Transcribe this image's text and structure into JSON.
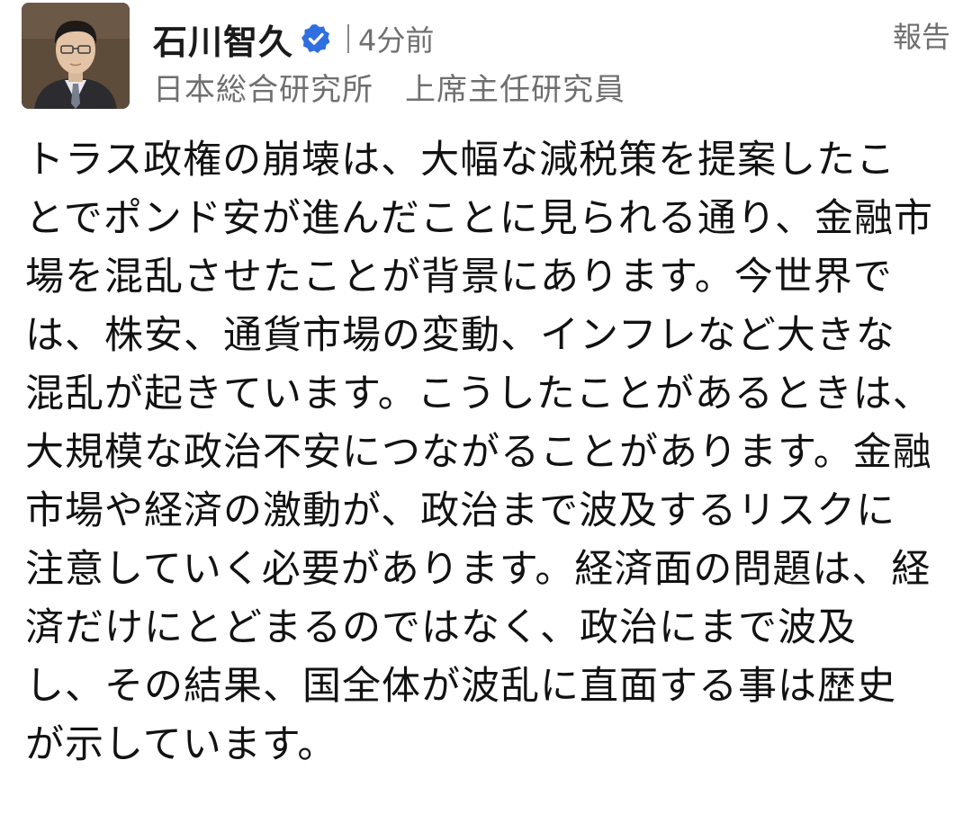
{
  "author": {
    "name": "石川智久",
    "affiliation": "日本総合研究所　上席主任研究員",
    "avatar_icon": "author-photo",
    "verified_icon": "verified-badge-icon",
    "verified_color": "#2f6fe0"
  },
  "timestamp": "4分前",
  "report_label": "報告",
  "comment": {
    "lines": [
      "トラス政権の崩壊は、大幅な減税策を提案したこ",
      "とでポンド安が進んだことに見られる通り、金融市",
      "場を混乱させたことが背景にあります。今世界で",
      "は、株安、通貨市場の変動、インフレなど大きな",
      "混乱が起きています。こうしたことがあるときは、",
      "大規模な政治不安につながることがあります。金融",
      "市場や経済の激動が、政治まで波及するリスクに",
      "注意していく必要があります。経済面の問題は、経",
      "済だけにとどまるのではなく、政治にまで波及",
      "し、その結果、国全体が波乱に直面する事は歴史",
      "が示しています。"
    ]
  }
}
